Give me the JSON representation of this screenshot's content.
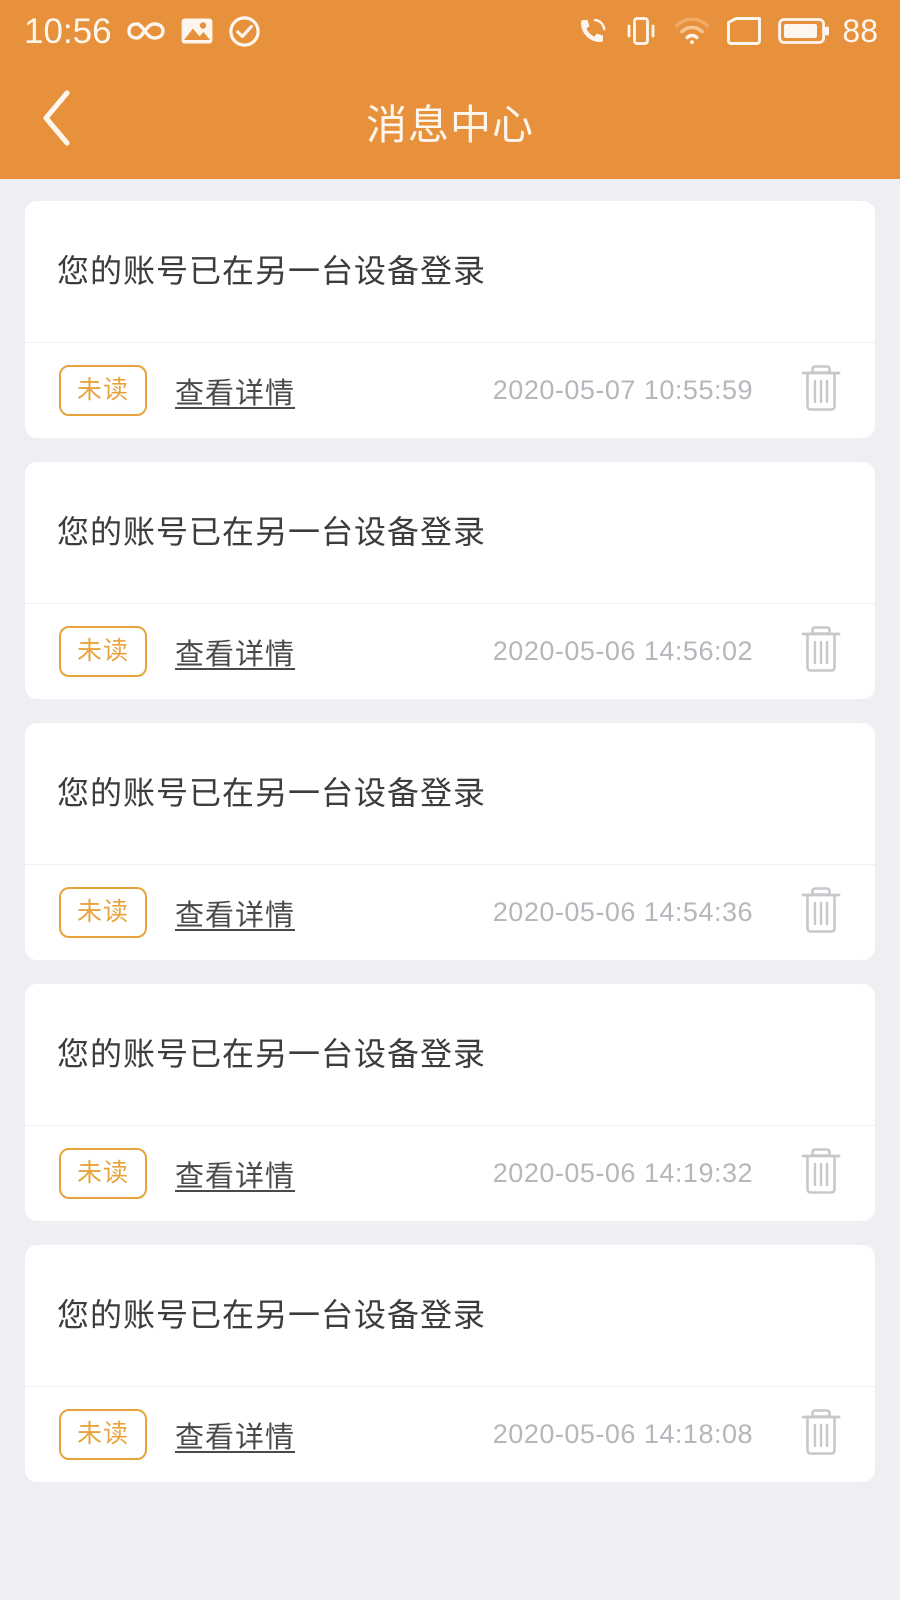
{
  "status_bar": {
    "time": "10:56",
    "battery_level": "88",
    "left_icons": [
      "infinity-icon",
      "photo-icon",
      "check-circle-icon"
    ],
    "right_icons": [
      "call-icon",
      "vibrate-icon",
      "wifi-icon",
      "sim-card-icon",
      "battery-icon"
    ]
  },
  "header": {
    "title": "消息中心",
    "back_icon": "chevron-left-icon",
    "background_color": "#e8913c",
    "text_color": "#fdf6ee"
  },
  "theme": {
    "accent": "#e8913c",
    "badge_border": "#e8a33c",
    "page_background": "#edeff2",
    "card_background": "#ffffff",
    "timestamp_color": "#b4b7bb"
  },
  "messages": [
    {
      "title": "您的账号已在另一台设备登录",
      "status_badge": "未读",
      "detail_label": "查看详情",
      "timestamp": "2020-05-07 10:55:59",
      "delete_icon": "trash-icon"
    },
    {
      "title": "您的账号已在另一台设备登录",
      "status_badge": "未读",
      "detail_label": "查看详情",
      "timestamp": "2020-05-06 14:56:02",
      "delete_icon": "trash-icon"
    },
    {
      "title": "您的账号已在另一台设备登录",
      "status_badge": "未读",
      "detail_label": "查看详情",
      "timestamp": "2020-05-06 14:54:36",
      "delete_icon": "trash-icon"
    },
    {
      "title": "您的账号已在另一台设备登录",
      "status_badge": "未读",
      "detail_label": "查看详情",
      "timestamp": "2020-05-06 14:19:32",
      "delete_icon": "trash-icon"
    },
    {
      "title": "您的账号已在另一台设备登录",
      "status_badge": "未读",
      "detail_label": "查看详情",
      "timestamp": "2020-05-06 14:18:08",
      "delete_icon": "trash-icon"
    }
  ]
}
